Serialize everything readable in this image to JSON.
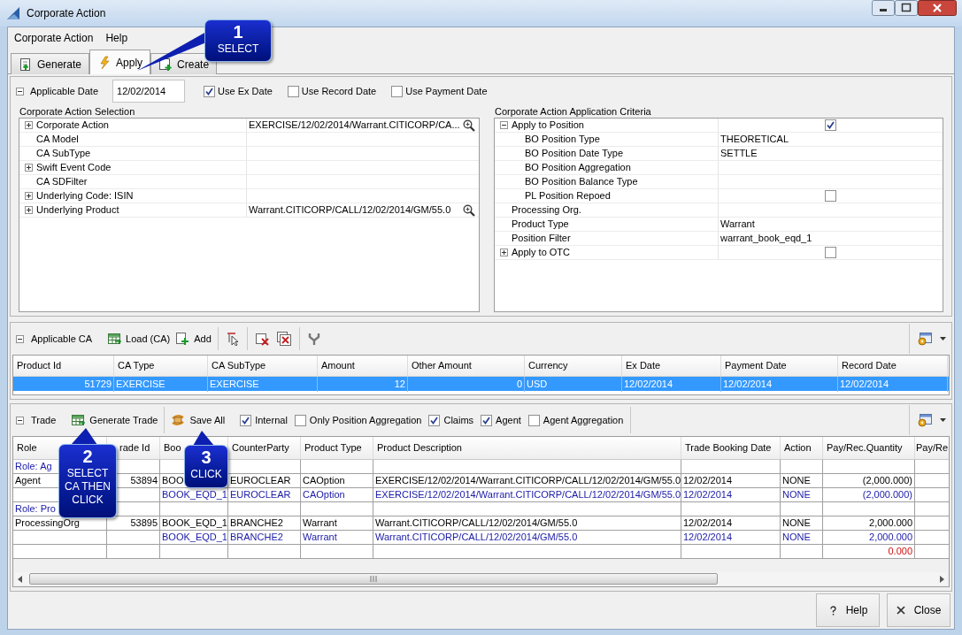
{
  "window": {
    "title": "Corporate Action"
  },
  "menu": [
    {
      "label": "Corporate Action"
    },
    {
      "label": "Help"
    }
  ],
  "tabs": [
    {
      "label": "Generate",
      "selected": false
    },
    {
      "label": "Apply",
      "selected": true
    },
    {
      "label": "Create",
      "selected": false
    }
  ],
  "applicable_date": {
    "label": "Applicable Date",
    "expanded": true,
    "value": "12/02/2014",
    "options": [
      {
        "label": "Use Ex Date",
        "checked": true
      },
      {
        "label": "Use Record Date",
        "checked": false
      },
      {
        "label": "Use Payment Date",
        "checked": false
      }
    ]
  },
  "ca_selection": {
    "title": "Corporate Action Selection",
    "rows": [
      {
        "label": "Corporate Action",
        "expanded": false,
        "kind": "lookup",
        "value": "EXERCISE/12/02/2014/Warrant.CITICORP/CA..."
      },
      {
        "label": "CA Model",
        "kind": "text"
      },
      {
        "label": "CA SubType",
        "kind": "text"
      },
      {
        "label": "Swift Event Code",
        "expanded": false,
        "kind": "text"
      },
      {
        "label": "CA SDFilter",
        "kind": "text"
      },
      {
        "label": "Underlying Code: ISIN",
        "expanded": false,
        "kind": "text"
      },
      {
        "label": "Underlying Product",
        "expanded": false,
        "kind": "lookup",
        "value": "Warrant.CITICORP/CALL/12/02/2014/GM/55.0"
      }
    ]
  },
  "criteria": {
    "title": "Corporate Action Application Criteria",
    "rows": [
      {
        "label": "Apply to Position",
        "expanded": true,
        "kind": "check",
        "checked": true,
        "children": [
          {
            "label": "BO Position Type",
            "kind": "text",
            "value": "THEORETICAL"
          },
          {
            "label": "BO Position Date Type",
            "kind": "text",
            "value": "SETTLE"
          },
          {
            "label": "BO Position Aggregation",
            "kind": "text"
          },
          {
            "label": "BO Position Balance Type",
            "kind": "text"
          },
          {
            "label": "PL Position Repoed",
            "kind": "check",
            "checked": false
          }
        ]
      },
      {
        "label": "Processing Org.",
        "kind": "text"
      },
      {
        "label": "Product Type",
        "kind": "text",
        "value": "Warrant"
      },
      {
        "label": "Position Filter",
        "kind": "text",
        "value": "warrant_book_eqd_1"
      },
      {
        "label": "Apply to OTC",
        "expanded": false,
        "kind": "check",
        "checked": false
      }
    ]
  },
  "applicable_ca": {
    "label": "Applicable CA",
    "expanded": true,
    "actions": [
      {
        "label": "Load (CA)"
      },
      {
        "label": "Add"
      }
    ],
    "columns": [
      "Product Id",
      "CA Type",
      "CA SubType",
      "Amount",
      "Other Amount",
      "Currency",
      "Ex Date",
      "Payment Date",
      "Record Date"
    ],
    "rows": [
      {
        "selected": true,
        "cells": [
          "51729",
          "EXERCISE",
          "EXERCISE",
          "12",
          "0",
          "USD",
          "12/02/2014",
          "12/02/2014",
          "12/02/2014"
        ]
      }
    ]
  },
  "trade": {
    "label": "Trade",
    "expanded": true,
    "actions": [
      {
        "label": "Generate Trade"
      },
      {
        "label": "Save All"
      }
    ],
    "options": [
      {
        "label": "Internal",
        "checked": true
      },
      {
        "label": "Only Position Aggregation",
        "checked": false
      },
      {
        "label": "Claims",
        "checked": true
      },
      {
        "label": "Agent",
        "checked": true
      },
      {
        "label": "Agent Aggregation",
        "checked": false
      }
    ],
    "columns": [
      "Role",
      "rade Id",
      "Boo",
      "CounterParty",
      "Product Type",
      "Product Description",
      "Trade Booking Date",
      "Action",
      "Pay/Rec.Quantity",
      "Pay/Re"
    ],
    "rows": [
      {
        "kind": "group",
        "cells": [
          "Role: Ag",
          null,
          null,
          null,
          null,
          null,
          null,
          null,
          null,
          null
        ]
      },
      {
        "kind": "trade",
        "cells": [
          "Agent",
          "53894",
          "BOO",
          "EUROCLEAR",
          "CAOption",
          "EXERCISE/12/02/2014/Warrant.CITICORP/CALL/12/02/2014/GM/55.0",
          "12/02/2014",
          "NONE",
          "(2,000.000)",
          null
        ]
      },
      {
        "kind": "leg",
        "cells": [
          null,
          null,
          "BOOK_EQD_1",
          "EUROCLEAR",
          "CAOption",
          "EXERCISE/12/02/2014/Warrant.CITICORP/CALL/12/02/2014/GM/55.0",
          "12/02/2014",
          "NONE",
          "(2,000.000)",
          null
        ]
      },
      {
        "kind": "group",
        "cells": [
          "Role: Pro",
          null,
          null,
          null,
          null,
          null,
          null,
          null,
          null,
          null
        ]
      },
      {
        "kind": "trade",
        "cells": [
          "ProcessingOrg",
          "53895",
          "BOOK_EQD_1",
          "BRANCHE2",
          "Warrant",
          "Warrant.CITICORP/CALL/12/02/2014/GM/55.0",
          "12/02/2014",
          "NONE",
          "2,000.000",
          null
        ]
      },
      {
        "kind": "leg",
        "cells": [
          null,
          null,
          "BOOK_EQD_1",
          "BRANCHE2",
          "Warrant",
          "Warrant.CITICORP/CALL/12/02/2014/GM/55.0",
          "12/02/2014",
          "NONE",
          "2,000.000",
          null
        ]
      },
      {
        "kind": "total",
        "cells": [
          null,
          null,
          null,
          null,
          null,
          null,
          null,
          null,
          "0.000",
          null
        ]
      }
    ]
  },
  "buttons": [
    {
      "label": "Help"
    },
    {
      "label": "Close"
    }
  ],
  "callouts": [
    {
      "number": "1",
      "text": "SELECT"
    },
    {
      "number": "2",
      "text": "SELECT CA THEN CLICK"
    },
    {
      "number": "3",
      "text": "CLICK"
    }
  ]
}
